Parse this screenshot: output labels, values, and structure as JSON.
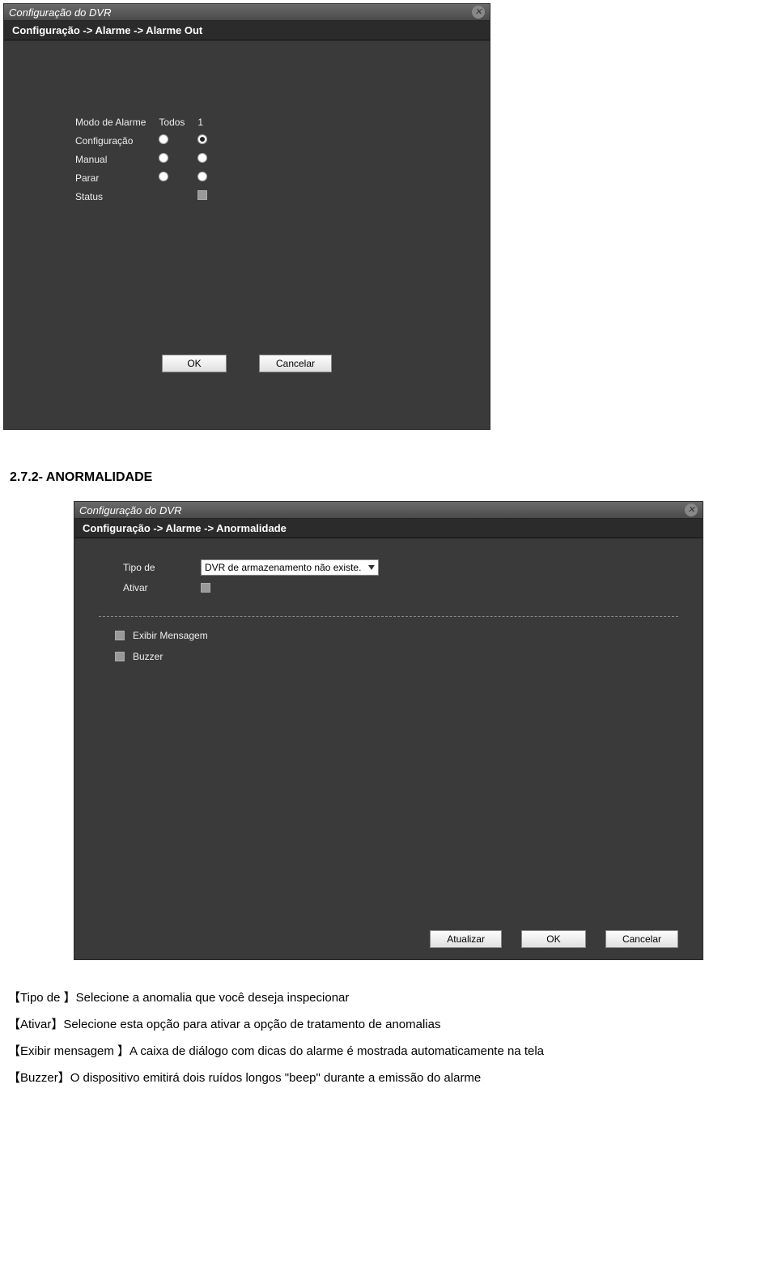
{
  "dialog1": {
    "title": "Configuração do DVR",
    "breadcrumb": "Configuração -> Alarme -> Alarme Out",
    "labels": {
      "modo": "Modo de Alarme",
      "configuracao": "Configuração",
      "manual": "Manual",
      "parar": "Parar",
      "status": "Status"
    },
    "cols": {
      "todos": "Todos",
      "one": "1"
    },
    "buttons": {
      "ok": "OK",
      "cancel": "Cancelar"
    }
  },
  "heading": "2.7.2- ANORMALIDADE",
  "dialog2": {
    "title": "Configuração do DVR",
    "breadcrumb": "Configuração -> Alarme -> Anormalidade",
    "labels": {
      "tipo": "Tipo de",
      "ativar": "Ativar",
      "exibir": "Exibir Mensagem",
      "buzzer": "Buzzer"
    },
    "select_value": "DVR de armazenamento não existe.",
    "buttons": {
      "atualizar": "Atualizar",
      "ok": "OK",
      "cancel": "Cancelar"
    }
  },
  "prose": {
    "l1a": "【Tipo de 】",
    "l1b": "Selecione a anomalia que você deseja inspecionar",
    "l2a": "【Ativar】",
    "l2b": "Selecione esta opção para ativar a opção de tratamento de anomalias",
    "l3a": "【Exibir mensagem 】",
    "l3b": "A caixa de diálogo com dicas do alarme é mostrada automaticamente na tela",
    "l4a": "【Buzzer】",
    "l4b": "O dispositivo emitirá dois ruídos longos \"beep\" durante a emissão do alarme"
  }
}
